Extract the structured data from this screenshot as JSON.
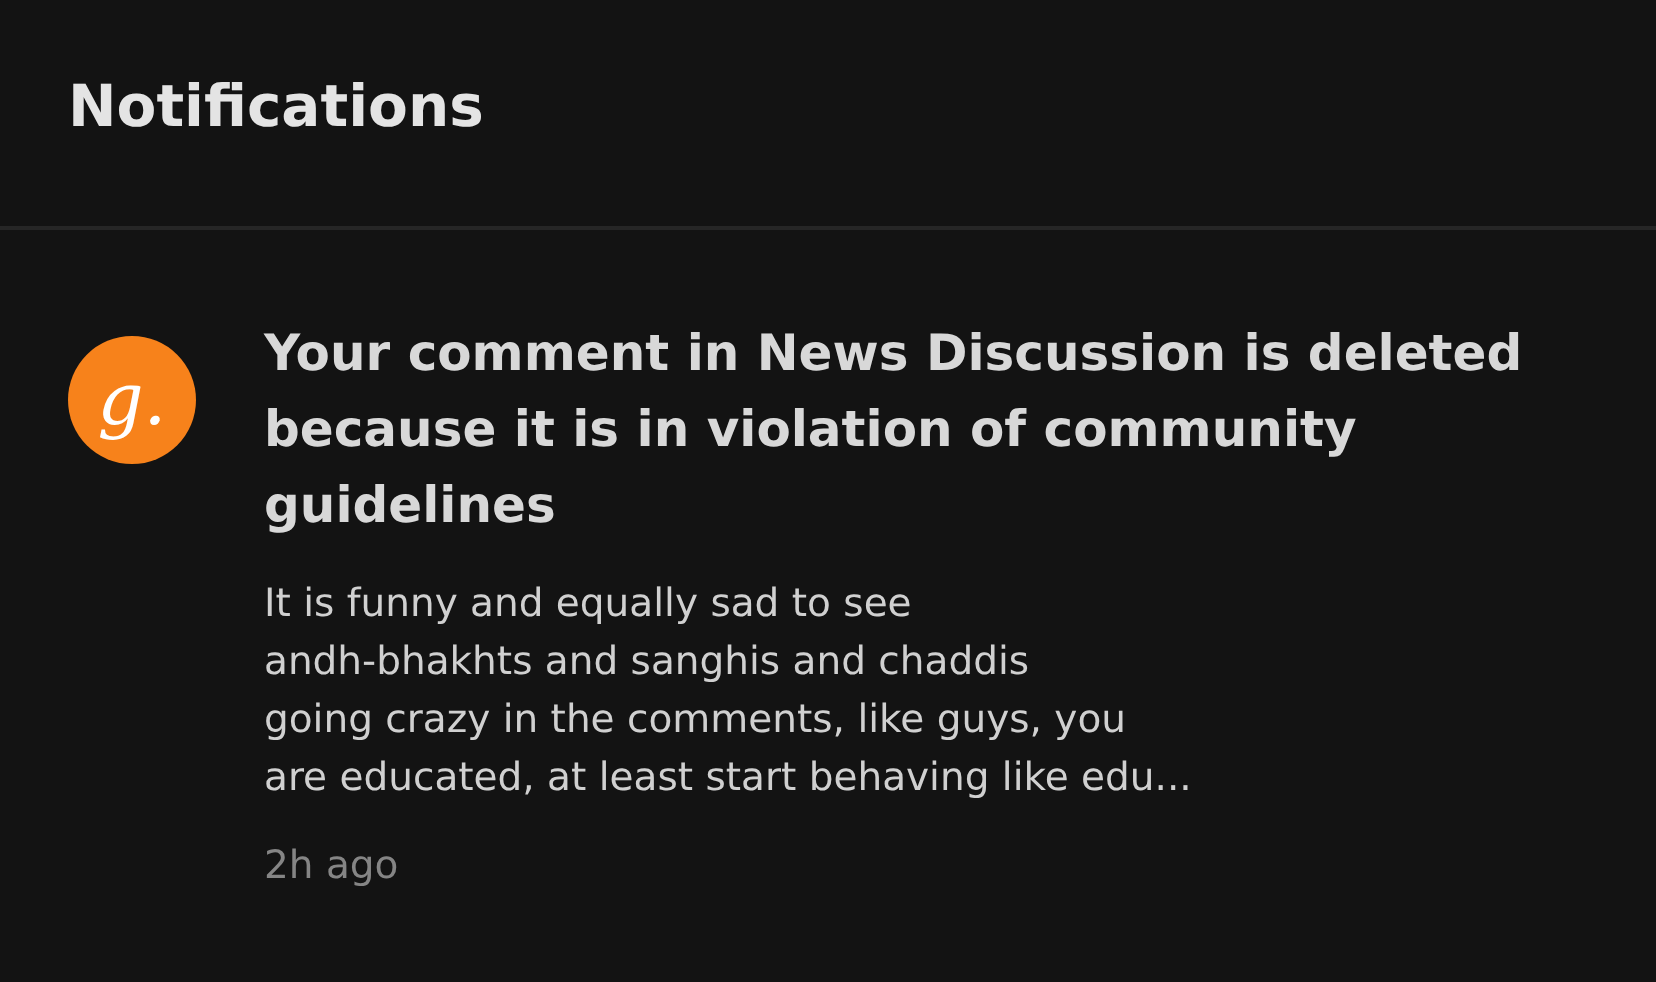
{
  "header": {
    "title": "Notifications"
  },
  "notifications": [
    {
      "avatar_text": "g.",
      "title": "Your comment in News Discussion is deleted\nbecause it is in violation of community\nguidelines",
      "body": "It is funny and equally sad to see\nandh-bhakhts and sanghis and chaddis\ngoing crazy in the comments, like guys, you\nare educated, at least start behaving like edu...",
      "time": "2h ago"
    }
  ]
}
